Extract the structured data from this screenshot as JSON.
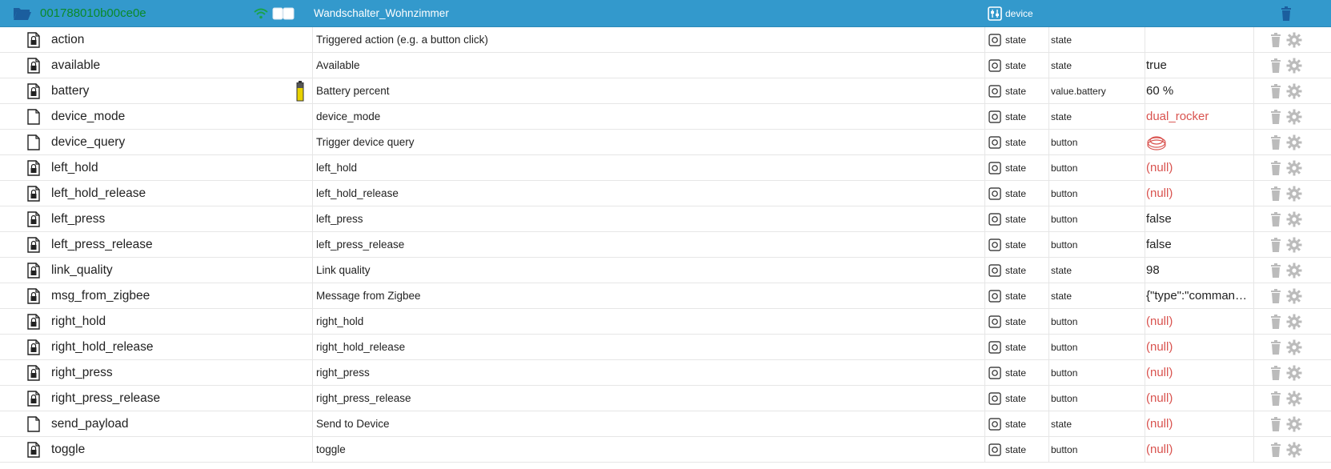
{
  "device": {
    "id": "001788010b00ce0e",
    "name": "Wandschalter_Wohnzimmer",
    "type": "device",
    "icons": [
      "folder-open-icon",
      "wifi-icon",
      "switch-device-icon",
      "device-type-icon",
      "trash-icon"
    ]
  },
  "states": [
    {
      "id": "action",
      "name": "Triggered action (e.g. a button click)",
      "type": "state",
      "role": "state",
      "value": "",
      "value_style": "normal",
      "locked": true
    },
    {
      "id": "available",
      "name": "Available",
      "type": "state",
      "role": "state",
      "value": "true",
      "value_style": "normal",
      "locked": true
    },
    {
      "id": "battery",
      "name": "Battery percent",
      "type": "state",
      "role": "value.battery",
      "value": "60 %",
      "value_style": "normal",
      "locked": true,
      "battery": true
    },
    {
      "id": "device_mode",
      "name": "device_mode",
      "type": "state",
      "role": "state",
      "value": "dual_rocker",
      "value_style": "red",
      "locked": false
    },
    {
      "id": "device_query",
      "name": "Trigger device query",
      "type": "state",
      "role": "button",
      "value": "",
      "value_style": "button",
      "locked": false
    },
    {
      "id": "left_hold",
      "name": "left_hold",
      "type": "state",
      "role": "button",
      "value": "(null)",
      "value_style": "null",
      "locked": true
    },
    {
      "id": "left_hold_release",
      "name": "left_hold_release",
      "type": "state",
      "role": "button",
      "value": "(null)",
      "value_style": "null",
      "locked": true
    },
    {
      "id": "left_press",
      "name": "left_press",
      "type": "state",
      "role": "button",
      "value": "false",
      "value_style": "normal",
      "locked": true
    },
    {
      "id": "left_press_release",
      "name": "left_press_release",
      "type": "state",
      "role": "button",
      "value": "false",
      "value_style": "normal",
      "locked": true
    },
    {
      "id": "link_quality",
      "name": "Link quality",
      "type": "state",
      "role": "state",
      "value": "98",
      "value_style": "normal",
      "locked": true
    },
    {
      "id": "msg_from_zigbee",
      "name": "Message from Zigbee",
      "type": "state",
      "role": "state",
      "value": "{\"type\":\"comman…",
      "value_style": "normal",
      "locked": true
    },
    {
      "id": "right_hold",
      "name": "right_hold",
      "type": "state",
      "role": "button",
      "value": "(null)",
      "value_style": "null",
      "locked": true
    },
    {
      "id": "right_hold_release",
      "name": "right_hold_release",
      "type": "state",
      "role": "button",
      "value": "(null)",
      "value_style": "null",
      "locked": true
    },
    {
      "id": "right_press",
      "name": "right_press",
      "type": "state",
      "role": "button",
      "value": "(null)",
      "value_style": "null",
      "locked": true
    },
    {
      "id": "right_press_release",
      "name": "right_press_release",
      "type": "state",
      "role": "button",
      "value": "(null)",
      "value_style": "null",
      "locked": true
    },
    {
      "id": "send_payload",
      "name": "Send to Device",
      "type": "state",
      "role": "state",
      "value": "(null)",
      "value_style": "null",
      "locked": false
    },
    {
      "id": "toggle",
      "name": "toggle",
      "type": "state",
      "role": "button",
      "value": "(null)",
      "value_style": "null",
      "locked": true
    }
  ],
  "colors": {
    "header_bg": "#3399cc",
    "device_id": "#0a8a2a",
    "null_value": "#d9534f",
    "icon_gray": "#bbbbbb"
  }
}
